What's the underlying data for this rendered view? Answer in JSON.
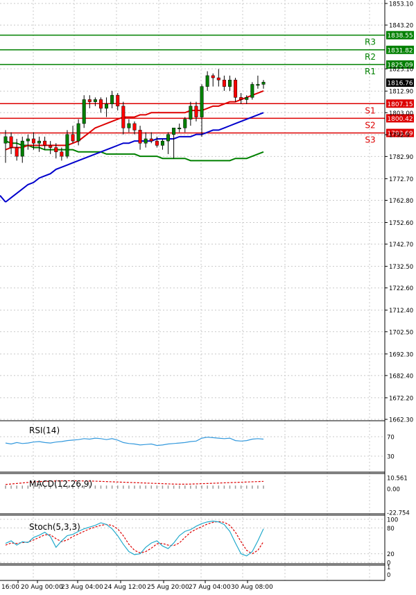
{
  "chart_data": [
    {
      "type": "candlestick",
      "ylim": [
        1662.3,
        1853.1
      ],
      "y_ticks": [
        1853.1,
        1843.2,
        1823.1,
        1812.9,
        1803.0,
        1792.9,
        1782.9,
        1772.7,
        1762.8,
        1752.6,
        1742.7,
        1732.5,
        1722.6,
        1712.4,
        1702.5,
        1692.3,
        1682.4,
        1672.2,
        1662.3
      ],
      "y_tick_labels": [
        "1853.10",
        "1843.20",
        "1823.10",
        "1812.90",
        "1803.00",
        "1792.9",
        "1782.90",
        "1772.70",
        "1762.80",
        "1752.60",
        "1742.70",
        "1732.50",
        "1722.60",
        "1712.40",
        "1702.50",
        "1692.30",
        "1682.40",
        "1672.20",
        "1662.30"
      ],
      "x_tick_labels": [
        "16:00",
        "20 Aug 00:00",
        "23 Aug 04:00",
        "24 Aug 12:00",
        "25 Aug 20:00",
        "27 Aug 04:00",
        "30 Aug 08:00"
      ],
      "current_price": 1816.76,
      "current_price_label": "1816.76",
      "levels": [
        {
          "name": "R3",
          "value": 1838.55,
          "label": "1838.55",
          "color": "#008000"
        },
        {
          "name": "R2",
          "value": 1831.82,
          "label": "1831.82",
          "color": "#008000"
        },
        {
          "name": "R1",
          "value": 1825.09,
          "label": "1825.09",
          "color": "#008000"
        },
        {
          "name": "S1",
          "value": 1807.15,
          "label": "1807.15",
          "color": "#dd0000"
        },
        {
          "name": "S2",
          "value": 1800.42,
          "label": "1800.42",
          "color": "#dd0000"
        },
        {
          "name": "S3",
          "value": 1793.69,
          "label": "1793.69",
          "color": "#dd0000"
        }
      ],
      "candles": [
        {
          "o": 1789,
          "h": 1795,
          "l": 1780,
          "c": 1792
        },
        {
          "o": 1792,
          "h": 1794,
          "l": 1784,
          "c": 1787
        },
        {
          "o": 1787,
          "h": 1791,
          "l": 1781,
          "c": 1783
        },
        {
          "o": 1783,
          "h": 1792,
          "l": 1780,
          "c": 1790
        },
        {
          "o": 1790,
          "h": 1793,
          "l": 1786,
          "c": 1791
        },
        {
          "o": 1791,
          "h": 1794,
          "l": 1786,
          "c": 1789
        },
        {
          "o": 1789,
          "h": 1792,
          "l": 1785,
          "c": 1790
        },
        {
          "o": 1790,
          "h": 1792,
          "l": 1786,
          "c": 1788
        },
        {
          "o": 1788,
          "h": 1790,
          "l": 1784,
          "c": 1787
        },
        {
          "o": 1787,
          "h": 1789,
          "l": 1782,
          "c": 1785
        },
        {
          "o": 1785,
          "h": 1787,
          "l": 1781,
          "c": 1783
        },
        {
          "o": 1783,
          "h": 1795,
          "l": 1782,
          "c": 1793
        },
        {
          "o": 1793,
          "h": 1797,
          "l": 1789,
          "c": 1790
        },
        {
          "o": 1790,
          "h": 1800,
          "l": 1788,
          "c": 1798
        },
        {
          "o": 1798,
          "h": 1811,
          "l": 1796,
          "c": 1809
        },
        {
          "o": 1809,
          "h": 1811,
          "l": 1805,
          "c": 1808
        },
        {
          "o": 1808,
          "h": 1810,
          "l": 1806,
          "c": 1809
        },
        {
          "o": 1809,
          "h": 1810,
          "l": 1803,
          "c": 1805
        },
        {
          "o": 1805,
          "h": 1810,
          "l": 1801,
          "c": 1807
        },
        {
          "o": 1807,
          "h": 1813,
          "l": 1805,
          "c": 1811
        },
        {
          "o": 1811,
          "h": 1812,
          "l": 1804,
          "c": 1806
        },
        {
          "o": 1806,
          "h": 1808,
          "l": 1793,
          "c": 1796
        },
        {
          "o": 1796,
          "h": 1800,
          "l": 1794,
          "c": 1798
        },
        {
          "o": 1798,
          "h": 1799,
          "l": 1793,
          "c": 1795
        },
        {
          "o": 1795,
          "h": 1797,
          "l": 1786,
          "c": 1789
        },
        {
          "o": 1789,
          "h": 1794,
          "l": 1787,
          "c": 1791
        },
        {
          "o": 1791,
          "h": 1794,
          "l": 1789,
          "c": 1790
        },
        {
          "o": 1790,
          "h": 1792,
          "l": 1787,
          "c": 1788
        },
        {
          "o": 1788,
          "h": 1791,
          "l": 1786,
          "c": 1790
        },
        {
          "o": 1790,
          "h": 1794,
          "l": 1784,
          "c": 1793
        },
        {
          "o": 1793,
          "h": 1796,
          "l": 1782,
          "c": 1796
        },
        {
          "o": 1796,
          "h": 1798,
          "l": 1794,
          "c": 1796
        },
        {
          "o": 1796,
          "h": 1801,
          "l": 1794,
          "c": 1800
        },
        {
          "o": 1800,
          "h": 1808,
          "l": 1797,
          "c": 1806
        },
        {
          "o": 1806,
          "h": 1808,
          "l": 1799,
          "c": 1801
        },
        {
          "o": 1801,
          "h": 1816,
          "l": 1792,
          "c": 1815
        },
        {
          "o": 1815,
          "h": 1822,
          "l": 1813,
          "c": 1820
        },
        {
          "o": 1820,
          "h": 1821,
          "l": 1815,
          "c": 1819
        },
        {
          "o": 1819,
          "h": 1823,
          "l": 1815,
          "c": 1818
        },
        {
          "o": 1818,
          "h": 1820,
          "l": 1813,
          "c": 1815
        },
        {
          "o": 1815,
          "h": 1820,
          "l": 1813,
          "c": 1818
        },
        {
          "o": 1818,
          "h": 1819,
          "l": 1808,
          "c": 1810
        },
        {
          "o": 1810,
          "h": 1812,
          "l": 1807,
          "c": 1809
        },
        {
          "o": 1809,
          "h": 1811,
          "l": 1807,
          "c": 1810
        },
        {
          "o": 1810,
          "h": 1817,
          "l": 1809,
          "c": 1816
        },
        {
          "o": 1816,
          "h": 1820,
          "l": 1814,
          "c": 1816
        },
        {
          "o": 1816,
          "h": 1818,
          "l": 1814,
          "c": 1817
        }
      ],
      "ma_fast": [
        1786,
        1787,
        1787,
        1787,
        1788,
        1788,
        1788,
        1788,
        1788,
        1788,
        1788,
        1788,
        1789,
        1790,
        1792,
        1794,
        1796,
        1797,
        1798,
        1799,
        1800,
        1801,
        1801,
        1801,
        1802,
        1802,
        1803,
        1803,
        1803,
        1803,
        1803,
        1803,
        1803,
        1804,
        1804,
        1804,
        1805,
        1806,
        1806,
        1807,
        1808,
        1808,
        1809,
        1810,
        1811,
        1812,
        1813
      ],
      "ma_mid": [
        1762,
        1764,
        1766,
        1768,
        1770,
        1771,
        1773,
        1774,
        1775,
        1777,
        1778,
        1779,
        1780,
        1781,
        1782,
        1783,
        1784,
        1785,
        1786,
        1787,
        1788,
        1789,
        1789,
        1790,
        1790,
        1790,
        1790,
        1791,
        1791,
        1791,
        1791,
        1792,
        1792,
        1792,
        1793,
        1793,
        1794,
        1795,
        1795,
        1796,
        1797,
        1798,
        1799,
        1800,
        1801,
        1802,
        1803
      ],
      "ma_slow": [
        1790,
        1789,
        1789,
        1788,
        1788,
        1787,
        1787,
        1786,
        1786,
        1786,
        1786,
        1786,
        1786,
        1785,
        1785,
        1785,
        1785,
        1785,
        1784,
        1784,
        1784,
        1784,
        1784,
        1784,
        1783,
        1783,
        1783,
        1783,
        1782,
        1782,
        1782,
        1782,
        1782,
        1781,
        1781,
        1781,
        1781,
        1781,
        1781,
        1781,
        1781,
        1782,
        1782,
        1782,
        1783,
        1784,
        1785
      ],
      "indicators": {
        "rsi": {
          "label": "RSI(14)",
          "ticks": [
            70,
            30
          ],
          "tick_labels": [
            "70",
            "30"
          ],
          "ylim": [
            0,
            100
          ],
          "values": [
            57,
            55,
            58,
            56,
            57,
            59,
            60,
            58,
            57,
            59,
            60,
            62,
            63,
            64,
            66,
            65,
            67,
            66,
            64,
            66,
            63,
            58,
            56,
            55,
            53,
            54,
            55,
            52,
            53,
            55,
            56,
            57,
            58,
            60,
            61,
            67,
            69,
            68,
            67,
            66,
            67,
            62,
            61,
            62,
            65,
            66,
            65
          ]
        },
        "macd": {
          "label": "MACD(12,26,9)",
          "ticks": [
            10.561,
            0.0,
            -22.754
          ],
          "tick_labels": [
            "10.561",
            "0.00",
            "-22.754"
          ],
          "ylim": [
            -22.754,
            10.561
          ],
          "histogram": [
            3,
            3,
            3,
            3,
            3,
            3,
            3,
            3,
            3,
            3,
            3,
            3,
            3,
            3,
            3,
            3,
            3,
            3,
            3,
            3,
            3,
            3,
            3,
            3,
            3,
            3,
            3,
            3,
            3,
            3,
            3,
            3,
            3,
            3,
            3,
            3,
            3,
            3,
            3,
            3,
            3,
            3,
            3,
            3,
            3,
            3,
            3
          ],
          "signal": [
            4,
            4.5,
            5,
            5.5,
            6,
            6.5,
            6.8,
            7,
            7.2,
            7.4,
            7.5,
            7.6,
            7.6,
            7.5,
            7.4,
            7.3,
            7.2,
            7,
            6.8,
            6.6,
            6.4,
            6.2,
            6,
            5.8,
            5.6,
            5.4,
            5.2,
            5,
            4.8,
            4.6,
            4.4,
            4.3,
            4.3,
            4.4,
            4.6,
            4.8,
            5,
            5.2,
            5.4,
            5.6,
            5.8,
            6,
            6.2,
            6.4,
            6.6,
            6.8,
            7
          ]
        },
        "stoch": {
          "label": "Stoch(5,3,3)",
          "ticks": [
            100,
            80,
            20,
            0
          ],
          "tick_labels": [
            "100",
            "80",
            "20",
            "0"
          ],
          "ylim": [
            0,
            100
          ],
          "main": [
            44,
            50,
            40,
            48,
            46,
            58,
            63,
            70,
            60,
            35,
            50,
            62,
            65,
            72,
            78,
            82,
            86,
            92,
            88,
            78,
            62,
            42,
            25,
            18,
            20,
            35,
            45,
            50,
            38,
            32,
            45,
            62,
            72,
            76,
            84,
            90,
            94,
            96,
            94,
            88,
            72,
            45,
            20,
            15,
            25,
            50,
            78
          ],
          "signal": [
            40,
            45,
            44,
            46,
            47,
            52,
            58,
            64,
            64,
            55,
            48,
            52,
            60,
            66,
            72,
            78,
            82,
            86,
            88,
            86,
            78,
            62,
            42,
            28,
            22,
            25,
            33,
            43,
            44,
            40,
            39,
            45,
            58,
            70,
            77,
            83,
            89,
            93,
            95,
            93,
            86,
            70,
            48,
            28,
            20,
            28,
            48
          ]
        }
      },
      "colors": {
        "bull": "#008000",
        "bear": "#ff0000",
        "ma_fast": "#dd0000",
        "ma_mid": "#0000cc",
        "ma_slow": "#008000",
        "rsi": "#3399dd",
        "macd_hist": "#999999",
        "macd_signal": "#dd0000",
        "stoch_main": "#22aacc",
        "stoch_signal": "#dd0000",
        "grid": "#c8c8c8"
      }
    }
  ]
}
